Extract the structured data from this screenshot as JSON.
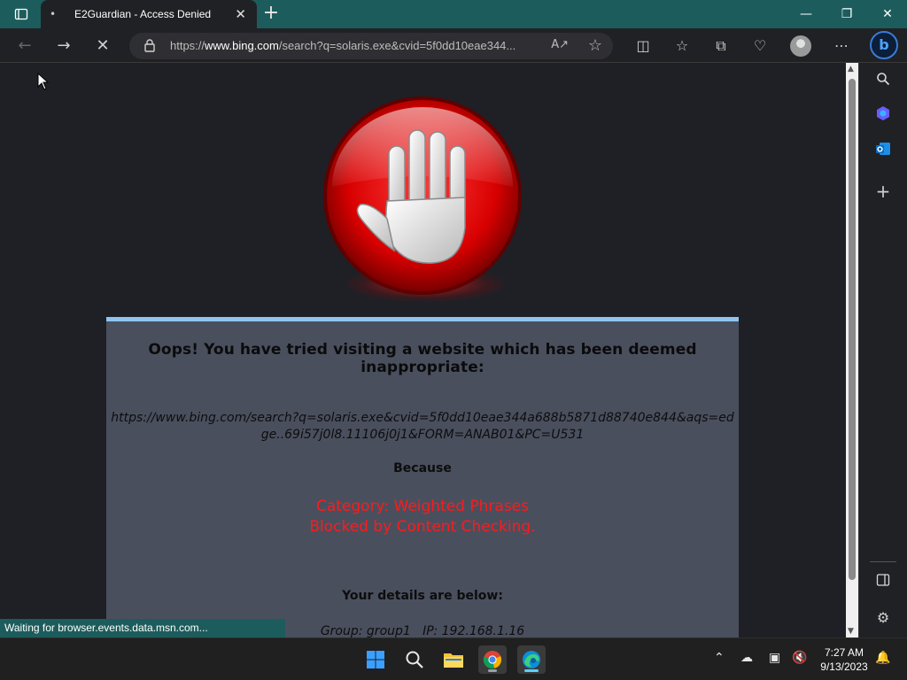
{
  "browser": {
    "tab_title": "E2Guardian - Access Denied",
    "address_bar": {
      "url_prefix": "https://",
      "url_host": "www.bing.com",
      "url_rest": "/search?q=solaris.exe&cvid=5f0dd10eae344..."
    },
    "status_text": "Waiting for browser.events.data.msn.com..."
  },
  "page": {
    "headline": "Oops! You have tried visiting a website which has been deemed inappropriate:",
    "blocked_url": "https://www.bing.com/search?q=solaris.exe&cvid=5f0dd10eae344a688b5871d88740e844&aqs=edge..69i57j0l8.11106j0j1&FORM=ANAB01&PC=U531",
    "because_label": "Because",
    "reason_line1": "Category: Weighted Phrases",
    "reason_line2": "Blocked by Content Checking.",
    "details_heading": "Your details are below:",
    "details_line": "Group: group1   IP: 192.168.1.16"
  },
  "taskbar": {
    "time": "7:27 AM",
    "date": "9/13/2023"
  },
  "colors": {
    "tabbar": "#1d5c5c",
    "panel": "#4a4f5e",
    "reason_text": "#ff1a1a",
    "panel_top_border": "#8fc4f0"
  },
  "icons": {
    "tab_actions": "tab-actions-icon",
    "loading": "loading-spinner-icon",
    "back": "back-arrow-icon",
    "forward": "forward-arrow-icon",
    "stop": "stop-loading-icon",
    "lock": "lock-icon",
    "read_aloud": "read-aloud-icon",
    "favorite": "star-icon",
    "split_screen": "split-screen-icon",
    "favorites": "favorites-icon",
    "collections": "collections-icon",
    "performance": "heartbeat-icon",
    "profile": "avatar-icon",
    "more": "more-icon",
    "copilot": "bing-icon",
    "sidebar_search": "search-icon",
    "sidebar_copilot": "copilot-icon",
    "sidebar_outlook": "outlook-icon",
    "sidebar_add": "plus-icon",
    "sidebar_layout": "sidebar-panel-icon",
    "sidebar_settings": "gear-icon",
    "stop_sign": "stop-hand-icon"
  }
}
